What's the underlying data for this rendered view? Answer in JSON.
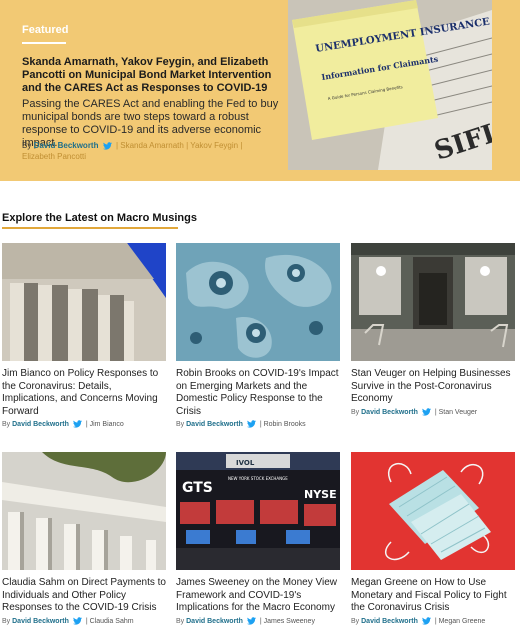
{
  "featured": {
    "tag": "Featured",
    "title": "Skanda Amarnath, Yakov Feygin, and Elizabeth Pancotti on Municipal Bond Market Intervention and the CARES Act as Responses to COVID-19",
    "description": "Passing the CARES Act and enabling the Fed to buy municipal bonds are two steps toward a robust response to COVID-19 and its adverse economic impact.",
    "byline": {
      "by": "By",
      "author": "David Beckworth",
      "guests": "| Skanda Amarnath | Yakov Feygin | Elizabeth Pancotti"
    },
    "image": {
      "headline": "UNEMPLOYMENT INSURANCE",
      "subhead": "Information for Claimants",
      "small": "A Guide for Persons Claiming Benefits"
    }
  },
  "section": {
    "title": "Explore the Latest on Macro Musings"
  },
  "cards": [
    {
      "title": "Jim Bianco on Policy Responses to the Coronavirus: Details, Implications, and Concerns Moving Forward",
      "by": "By",
      "author": "David Beckworth",
      "guest": "| Jim Bianco"
    },
    {
      "title": "Robin Brooks on COVID-19's Impact on Emerging Markets and the Domestic Policy Response to the Crisis",
      "by": "By",
      "author": "David Beckworth",
      "guest": "| Robin Brooks"
    },
    {
      "title": "Stan Veuger on Helping Businesses Survive in the Post-Coronavirus Economy",
      "by": "By",
      "author": "David Beckworth",
      "guest": "| Stan Veuger"
    },
    {
      "title": "Claudia Sahm on Direct Payments to Individuals and Other Policy Responses to the COVID-19 Crisis",
      "by": "By",
      "author": "David Beckworth",
      "guest": "| Claudia Sahm"
    },
    {
      "title": "James Sweeney on the Money View Framework and COVID-19's Implications for the Macro Economy",
      "by": "By",
      "author": "David Beckworth",
      "guest": "| James Sweeney",
      "image_text": {
        "gts": "GTS",
        "nyse": "NYSE",
        "sign": "NEW YORK STOCK EXCHANGE"
      }
    },
    {
      "title": "Megan Greene on How to Use Monetary and Fiscal Policy to Fight the Coronavirus Crisis",
      "by": "By",
      "author": "David Beckworth",
      "guest": "| Megan Greene"
    }
  ],
  "colors": {
    "featured_bg": "#f2c974",
    "accent_line": "#e1a73a",
    "author_link": "#1f6f8b",
    "twitter": "#1da1f2"
  },
  "icons": {
    "twitter": "twitter-bird-icon"
  }
}
